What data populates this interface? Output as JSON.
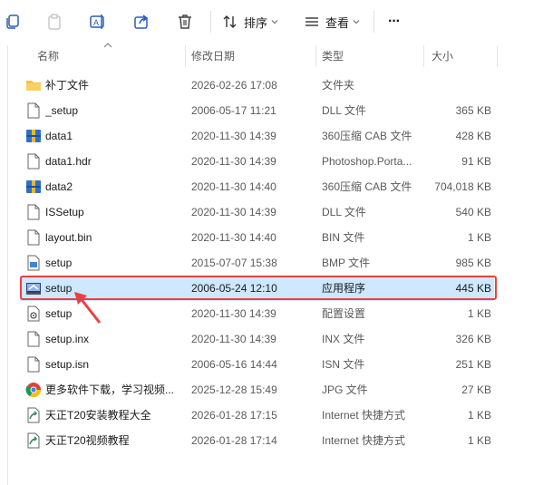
{
  "toolbar": {
    "sort_label": "排序",
    "view_label": "查看",
    "more_label": "···"
  },
  "header": {
    "name": "名称",
    "date": "修改日期",
    "type": "类型",
    "size": "大小"
  },
  "files": [
    {
      "name": "补丁文件",
      "date": "2026-02-26 17:08",
      "type": "文件夹",
      "size": "",
      "icon": "folder-icon"
    },
    {
      "name": "_setup",
      "date": "2006-05-17 11:21",
      "type": "DLL 文件",
      "size": "365 KB",
      "icon": "file-icon"
    },
    {
      "name": "data1",
      "date": "2020-11-30 14:39",
      "type": "360压缩 CAB 文件",
      "size": "428 KB",
      "icon": "archive-icon"
    },
    {
      "name": "data1.hdr",
      "date": "2020-11-30 14:39",
      "type": "Photoshop.Porta...",
      "size": "91 KB",
      "icon": "file-icon"
    },
    {
      "name": "data2",
      "date": "2020-11-30 14:40",
      "type": "360压缩 CAB 文件",
      "size": "704,018 KB",
      "icon": "archive-icon"
    },
    {
      "name": "ISSetup",
      "date": "2020-11-30 14:39",
      "type": "DLL 文件",
      "size": "540 KB",
      "icon": "file-icon"
    },
    {
      "name": "layout.bin",
      "date": "2020-11-30 14:40",
      "type": "BIN 文件",
      "size": "1 KB",
      "icon": "file-icon"
    },
    {
      "name": "setup",
      "date": "2015-07-07 15:38",
      "type": "BMP 文件",
      "size": "985 KB",
      "icon": "image-file-icon"
    },
    {
      "name": "setup",
      "date": "2006-05-24 12:10",
      "type": "应用程序",
      "size": "445 KB",
      "icon": "installer-icon",
      "selected": true
    },
    {
      "name": "setup",
      "date": "2020-11-30 14:39",
      "type": "配置设置",
      "size": "1 KB",
      "icon": "settings-file-icon"
    },
    {
      "name": "setup.inx",
      "date": "2020-11-30 14:39",
      "type": "INX 文件",
      "size": "326 KB",
      "icon": "file-icon"
    },
    {
      "name": "setup.isn",
      "date": "2006-05-16 14:44",
      "type": "ISN 文件",
      "size": "251 KB",
      "icon": "file-icon"
    },
    {
      "name": "更多软件下载，学习视频...",
      "date": "2025-12-28 15:49",
      "type": "JPG 文件",
      "size": "27 KB",
      "icon": "chrome-icon"
    },
    {
      "name": "天正T20安装教程大全",
      "date": "2026-01-28 17:15",
      "type": "Internet 快捷方式",
      "size": "1 KB",
      "icon": "shortcut-icon"
    },
    {
      "name": "天正T20视频教程",
      "date": "2026-01-28 17:14",
      "type": "Internet 快捷方式",
      "size": "1 KB",
      "icon": "shortcut-icon"
    }
  ],
  "colors": {
    "selection": "#cde8ff",
    "annotation": "#e8413f",
    "folder": "#f5c342"
  }
}
